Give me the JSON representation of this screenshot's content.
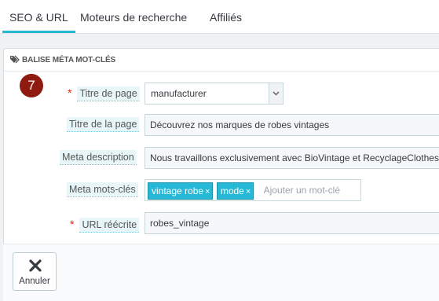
{
  "tabs": [
    {
      "label": "SEO & URL",
      "active": true
    },
    {
      "label": "Moteurs de recherche",
      "active": false
    },
    {
      "label": "Affiliés",
      "active": false
    }
  ],
  "panel": {
    "heading": "BALISE MÉTA MOT-CLÉS",
    "heading_icon": "tag-icon",
    "step_number": "7"
  },
  "fields": {
    "page_title_select": {
      "label": "Titre de page",
      "required": true,
      "value": "manufacturer"
    },
    "page_title": {
      "label": "Titre de la page",
      "value": "Découvrez nos marques de robes vintages"
    },
    "meta_description": {
      "label": "Meta description",
      "value": "Nous travaillons exclusivement avec BioVintage et RecyclageClothes"
    },
    "meta_keywords": {
      "label": "Meta mots-clés",
      "tags": [
        "vintage robe",
        "mode"
      ],
      "placeholder": "Ajouter un mot-clé"
    },
    "rewritten_url": {
      "label": "URL réécrite",
      "required": true,
      "value": "robes_vintage"
    }
  },
  "required_marker": "*",
  "footer": {
    "cancel_label": "Annuler",
    "cancel_icon": "close-icon"
  },
  "colors": {
    "accent": "#25b9d7",
    "badge": "#8f1b10",
    "required": "#e3260e"
  }
}
